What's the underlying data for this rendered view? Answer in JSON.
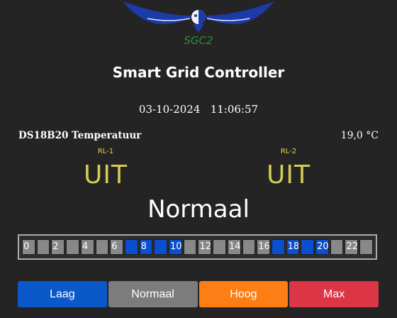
{
  "logo": {
    "text": "SGC2"
  },
  "header": {
    "title": "Smart Grid Controller"
  },
  "datetime": {
    "date": "03-10-2024",
    "time": "11:06:57"
  },
  "sensor": {
    "label": "DS18B20 Temperatuur",
    "value": "19,0 °C"
  },
  "relays": [
    {
      "label": "RL-1",
      "state": "UIT"
    },
    {
      "label": "RL-2",
      "state": "UIT"
    }
  ],
  "mode": {
    "current": "Normaal"
  },
  "schedule": {
    "colors": {
      "gray": "#888888",
      "blue": "#0a4fcf"
    },
    "hours": [
      {
        "label": "0",
        "state": "gray"
      },
      {
        "label": "",
        "state": "gray"
      },
      {
        "label": "2",
        "state": "gray"
      },
      {
        "label": "",
        "state": "gray"
      },
      {
        "label": "4",
        "state": "gray"
      },
      {
        "label": "",
        "state": "gray"
      },
      {
        "label": "6",
        "state": "gray"
      },
      {
        "label": "",
        "state": "blue"
      },
      {
        "label": "8",
        "state": "blue"
      },
      {
        "label": "",
        "state": "blue"
      },
      {
        "label": "10",
        "state": "blue"
      },
      {
        "label": "",
        "state": "gray"
      },
      {
        "label": "12",
        "state": "gray"
      },
      {
        "label": "",
        "state": "gray"
      },
      {
        "label": "14",
        "state": "gray"
      },
      {
        "label": "",
        "state": "gray"
      },
      {
        "label": "16",
        "state": "gray"
      },
      {
        "label": "",
        "state": "blue"
      },
      {
        "label": "18",
        "state": "blue"
      },
      {
        "label": "",
        "state": "blue"
      },
      {
        "label": "20",
        "state": "blue"
      },
      {
        "label": "",
        "state": "gray"
      },
      {
        "label": "22",
        "state": "gray"
      },
      {
        "label": "",
        "state": "gray"
      }
    ]
  },
  "buttons": {
    "laag": "Laag",
    "normaal": "Normaal",
    "hoog": "Hoog",
    "max": "Max"
  },
  "colors": {
    "laag": "#0a58ca",
    "normaal": "#7c7c7c",
    "hoog": "#fd7e14",
    "max": "#dc3545",
    "relay_state": "#d4cc55",
    "logo_text": "#2e8b3a"
  }
}
